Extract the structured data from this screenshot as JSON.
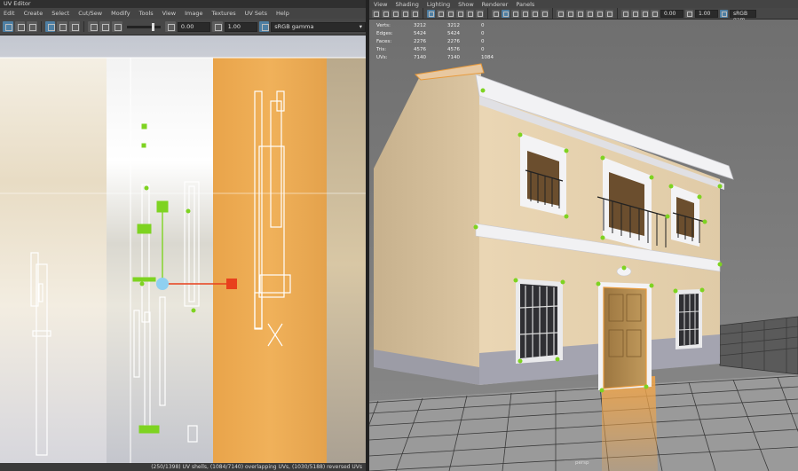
{
  "uv_editor": {
    "title": "UV Editor",
    "menu": [
      "Edit",
      "Create",
      "Select",
      "Cut/Sew",
      "Modify",
      "Tools",
      "View",
      "Image",
      "Textures",
      "UV Sets",
      "Help"
    ],
    "toolbar": {
      "exposure_value": "0.00",
      "gamma_value": "1.00",
      "color_space": "sRGB gamma"
    },
    "status": "(250/1398) UV shells, (1084/7140) overlapping UVs, (1030/5188) reversed UVs"
  },
  "viewport": {
    "menu": [
      "View",
      "Shading",
      "Lighting",
      "Show",
      "Renderer",
      "Panels"
    ],
    "toolbar": {
      "exposure_value": "0.00",
      "gamma_value": "1.00",
      "color_space": "sRGB gam"
    },
    "hud": [
      {
        "label": "Verts:",
        "v1": "3212",
        "v2": "3212",
        "v3": "0"
      },
      {
        "label": "Edges:",
        "v1": "5424",
        "v2": "5424",
        "v3": "0"
      },
      {
        "label": "Faces:",
        "v1": "2276",
        "v2": "2276",
        "v3": "0"
      },
      {
        "label": "Tris:",
        "v1": "4576",
        "v2": "4576",
        "v3": "0"
      },
      {
        "label": "UVs:",
        "v1": "7140",
        "v2": "7140",
        "v3": "1084"
      }
    ],
    "camera_label": "persp"
  },
  "colors": {
    "uv_grid_line": "#ffffff",
    "uv_selection": "#7ed321",
    "uv_highlight_orange": "#e89a3c",
    "manipulator_red": "#e8401c",
    "manipulator_blue": "#8fd0f0",
    "wall": "#e7d2b0",
    "wall_shadow": "#c9b28e",
    "plinth": "#a4a4b0",
    "cornice": "#f2f2f4",
    "door": "#b08a4e",
    "ground_grid": "#3a3a3a"
  },
  "icons": {
    "uv_toolbar": [
      "select-icon",
      "tweak-icon",
      "shell-icon",
      "grid-icon",
      "checker-icon",
      "snapshot-icon",
      "shaded-uv-icon",
      "distortion-icon",
      "image-icon",
      "exposure-icon",
      "gamma-icon",
      "color-space-icon"
    ],
    "viewport_toolbar": [
      "camera-icon",
      "grid-icon",
      "wireframe-icon",
      "smooth-shade-icon",
      "textured-icon",
      "lighting-icon",
      "shadow-icon",
      "xray-icon",
      "isolate-icon"
    ]
  }
}
